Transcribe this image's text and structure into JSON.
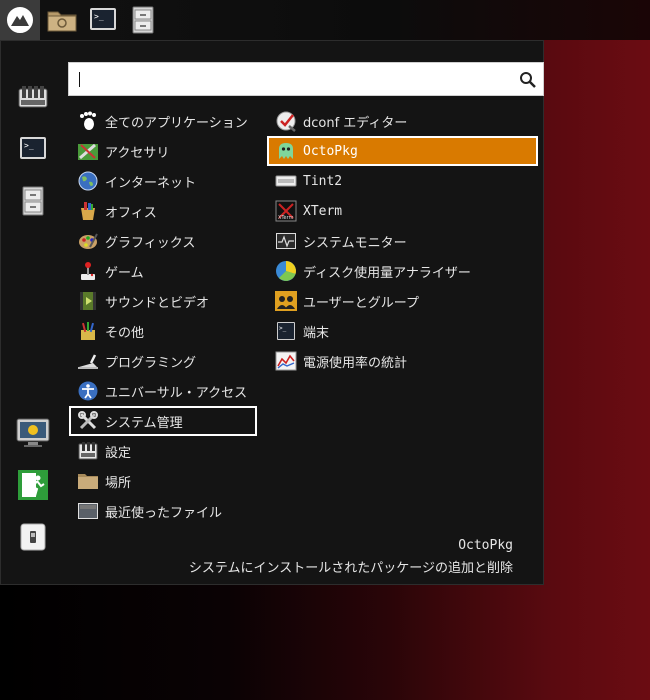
{
  "taskbar": {
    "items": [
      {
        "name": "start-menu-button",
        "icon": "logo-icon"
      },
      {
        "name": "file-manager-launcher",
        "icon": "folder-icon"
      },
      {
        "name": "terminal-launcher",
        "icon": "terminal-icon"
      },
      {
        "name": "archive-launcher",
        "icon": "cabinet-icon"
      }
    ]
  },
  "search": {
    "value": "",
    "placeholder": ""
  },
  "sidebar": {
    "items": [
      {
        "icon": "settings-panel-icon"
      },
      {
        "icon": "terminal-icon"
      },
      {
        "icon": "file-cabinet-icon"
      },
      {
        "icon": "lock-screen-icon"
      },
      {
        "icon": "logout-icon"
      },
      {
        "icon": "shutdown-icon"
      }
    ]
  },
  "categories": [
    {
      "label": "全てのアプリケーション",
      "icon": "gnome-foot-icon"
    },
    {
      "label": "アクセサリ",
      "icon": "accessories-icon"
    },
    {
      "label": "インターネット",
      "icon": "globe-icon"
    },
    {
      "label": "オフィス",
      "icon": "office-icon"
    },
    {
      "label": "グラフィックス",
      "icon": "palette-icon"
    },
    {
      "label": "ゲーム",
      "icon": "joystick-icon"
    },
    {
      "label": "サウンドとビデオ",
      "icon": "film-icon"
    },
    {
      "label": "その他",
      "icon": "other-icon"
    },
    {
      "label": "プログラミング",
      "icon": "trowel-icon"
    },
    {
      "label": "ユニバーサル・アクセス",
      "icon": "accessibility-icon"
    },
    {
      "label": "システム管理",
      "icon": "tools-icon"
    },
    {
      "label": "設定",
      "icon": "settings-icon"
    },
    {
      "label": "場所",
      "icon": "folder-icon"
    },
    {
      "label": "最近使ったファイル",
      "icon": "recent-files-icon"
    }
  ],
  "apps": [
    {
      "label": "dconf エディター",
      "icon": "dconf-icon"
    },
    {
      "label": "OctoPkg",
      "icon": "octopkg-icon"
    },
    {
      "label": "Tint2",
      "icon": "tint2-icon"
    },
    {
      "label": "XTerm",
      "icon": "xterm-icon"
    },
    {
      "label": "システムモニター",
      "icon": "system-monitor-icon"
    },
    {
      "label": "ディスク使用量アナライザー",
      "icon": "disk-usage-icon"
    },
    {
      "label": "ユーザーとグループ",
      "icon": "users-icon"
    },
    {
      "label": "端末",
      "icon": "terminal-icon"
    },
    {
      "label": "電源使用率の統計",
      "icon": "power-stats-icon"
    }
  ],
  "description": {
    "name": "OctoPkg",
    "text": "システムにインストールされたパッケージの追加と削除"
  },
  "colors": {
    "selection": "#d97a00",
    "menu_bg": "#141414",
    "wallpaper_accent": "#6b0c12"
  }
}
